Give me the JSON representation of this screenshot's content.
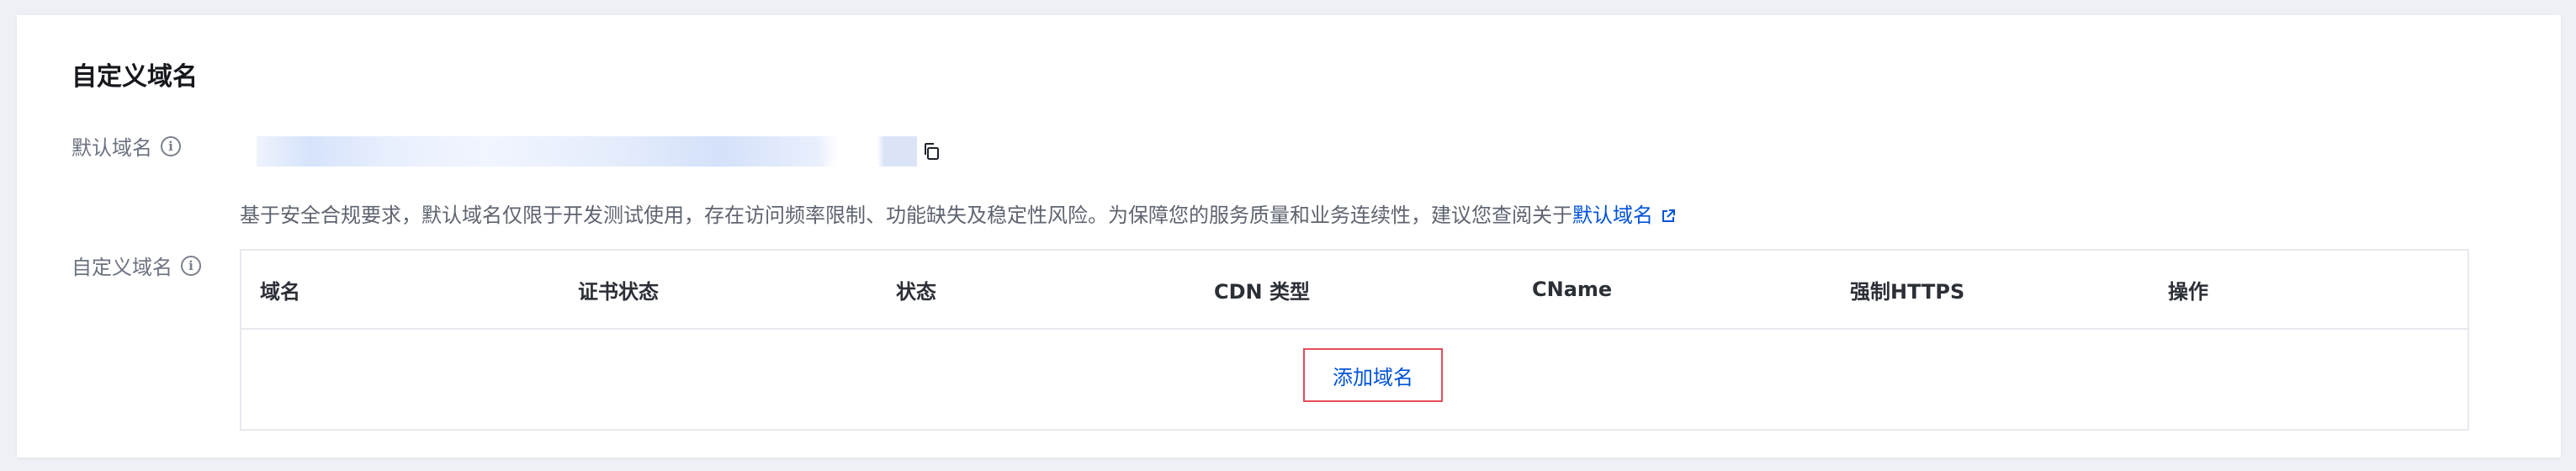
{
  "card": {
    "title": "自定义域名"
  },
  "default_domain": {
    "label": "默认域名",
    "notice_text": "基于安全合规要求，默认域名仅限于开发测试使用，存在访问频率限制、功能缺失及稳定性风险。为保障您的服务质量和业务连续性，建议您查阅关于",
    "notice_link": "默认域名"
  },
  "custom_domain": {
    "label": "自定义域名",
    "columns": [
      "域名",
      "证书状态",
      "状态",
      "CDN 类型",
      "CName",
      "强制HTTPS",
      "操作"
    ],
    "add_button": "添加域名"
  },
  "colors": {
    "link": "#0052d9",
    "highlight_border": "#e34d59"
  },
  "icons": [
    "info-icon",
    "copy-icon",
    "external-link-icon"
  ]
}
